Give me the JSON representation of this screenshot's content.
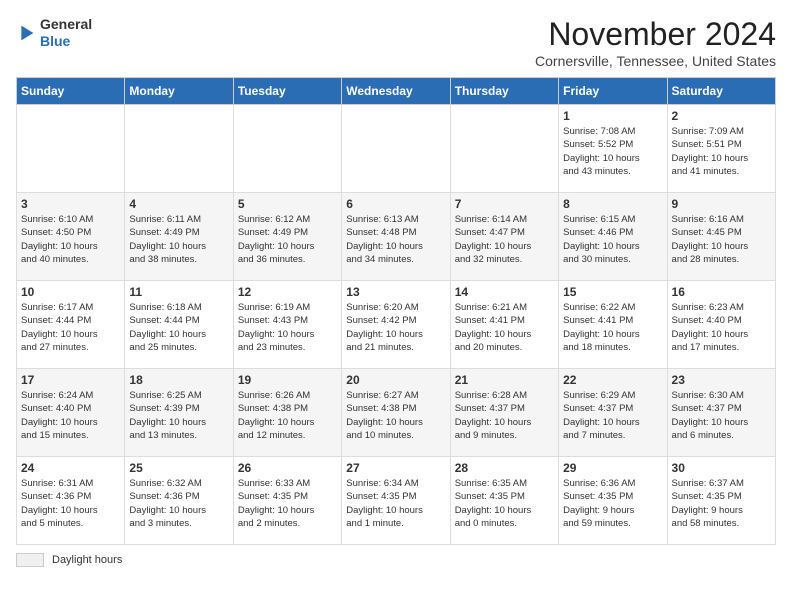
{
  "header": {
    "logo": {
      "general": "General",
      "blue": "Blue"
    },
    "month_title": "November 2024",
    "location": "Cornersville, Tennessee, United States"
  },
  "calendar": {
    "days_of_week": [
      "Sunday",
      "Monday",
      "Tuesday",
      "Wednesday",
      "Thursday",
      "Friday",
      "Saturday"
    ],
    "weeks": [
      [
        {
          "day": "",
          "info": ""
        },
        {
          "day": "",
          "info": ""
        },
        {
          "day": "",
          "info": ""
        },
        {
          "day": "",
          "info": ""
        },
        {
          "day": "",
          "info": ""
        },
        {
          "day": "1",
          "info": "Sunrise: 7:08 AM\nSunset: 5:52 PM\nDaylight: 10 hours\nand 43 minutes."
        },
        {
          "day": "2",
          "info": "Sunrise: 7:09 AM\nSunset: 5:51 PM\nDaylight: 10 hours\nand 41 minutes."
        }
      ],
      [
        {
          "day": "3",
          "info": "Sunrise: 6:10 AM\nSunset: 4:50 PM\nDaylight: 10 hours\nand 40 minutes."
        },
        {
          "day": "4",
          "info": "Sunrise: 6:11 AM\nSunset: 4:49 PM\nDaylight: 10 hours\nand 38 minutes."
        },
        {
          "day": "5",
          "info": "Sunrise: 6:12 AM\nSunset: 4:49 PM\nDaylight: 10 hours\nand 36 minutes."
        },
        {
          "day": "6",
          "info": "Sunrise: 6:13 AM\nSunset: 4:48 PM\nDaylight: 10 hours\nand 34 minutes."
        },
        {
          "day": "7",
          "info": "Sunrise: 6:14 AM\nSunset: 4:47 PM\nDaylight: 10 hours\nand 32 minutes."
        },
        {
          "day": "8",
          "info": "Sunrise: 6:15 AM\nSunset: 4:46 PM\nDaylight: 10 hours\nand 30 minutes."
        },
        {
          "day": "9",
          "info": "Sunrise: 6:16 AM\nSunset: 4:45 PM\nDaylight: 10 hours\nand 28 minutes."
        }
      ],
      [
        {
          "day": "10",
          "info": "Sunrise: 6:17 AM\nSunset: 4:44 PM\nDaylight: 10 hours\nand 27 minutes."
        },
        {
          "day": "11",
          "info": "Sunrise: 6:18 AM\nSunset: 4:44 PM\nDaylight: 10 hours\nand 25 minutes."
        },
        {
          "day": "12",
          "info": "Sunrise: 6:19 AM\nSunset: 4:43 PM\nDaylight: 10 hours\nand 23 minutes."
        },
        {
          "day": "13",
          "info": "Sunrise: 6:20 AM\nSunset: 4:42 PM\nDaylight: 10 hours\nand 21 minutes."
        },
        {
          "day": "14",
          "info": "Sunrise: 6:21 AM\nSunset: 4:41 PM\nDaylight: 10 hours\nand 20 minutes."
        },
        {
          "day": "15",
          "info": "Sunrise: 6:22 AM\nSunset: 4:41 PM\nDaylight: 10 hours\nand 18 minutes."
        },
        {
          "day": "16",
          "info": "Sunrise: 6:23 AM\nSunset: 4:40 PM\nDaylight: 10 hours\nand 17 minutes."
        }
      ],
      [
        {
          "day": "17",
          "info": "Sunrise: 6:24 AM\nSunset: 4:40 PM\nDaylight: 10 hours\nand 15 minutes."
        },
        {
          "day": "18",
          "info": "Sunrise: 6:25 AM\nSunset: 4:39 PM\nDaylight: 10 hours\nand 13 minutes."
        },
        {
          "day": "19",
          "info": "Sunrise: 6:26 AM\nSunset: 4:38 PM\nDaylight: 10 hours\nand 12 minutes."
        },
        {
          "day": "20",
          "info": "Sunrise: 6:27 AM\nSunset: 4:38 PM\nDaylight: 10 hours\nand 10 minutes."
        },
        {
          "day": "21",
          "info": "Sunrise: 6:28 AM\nSunset: 4:37 PM\nDaylight: 10 hours\nand 9 minutes."
        },
        {
          "day": "22",
          "info": "Sunrise: 6:29 AM\nSunset: 4:37 PM\nDaylight: 10 hours\nand 7 minutes."
        },
        {
          "day": "23",
          "info": "Sunrise: 6:30 AM\nSunset: 4:37 PM\nDaylight: 10 hours\nand 6 minutes."
        }
      ],
      [
        {
          "day": "24",
          "info": "Sunrise: 6:31 AM\nSunset: 4:36 PM\nDaylight: 10 hours\nand 5 minutes."
        },
        {
          "day": "25",
          "info": "Sunrise: 6:32 AM\nSunset: 4:36 PM\nDaylight: 10 hours\nand 3 minutes."
        },
        {
          "day": "26",
          "info": "Sunrise: 6:33 AM\nSunset: 4:35 PM\nDaylight: 10 hours\nand 2 minutes."
        },
        {
          "day": "27",
          "info": "Sunrise: 6:34 AM\nSunset: 4:35 PM\nDaylight: 10 hours\nand 1 minute."
        },
        {
          "day": "28",
          "info": "Sunrise: 6:35 AM\nSunset: 4:35 PM\nDaylight: 10 hours\nand 0 minutes."
        },
        {
          "day": "29",
          "info": "Sunrise: 6:36 AM\nSunset: 4:35 PM\nDaylight: 9 hours\nand 59 minutes."
        },
        {
          "day": "30",
          "info": "Sunrise: 6:37 AM\nSunset: 4:35 PM\nDaylight: 9 hours\nand 58 minutes."
        }
      ]
    ]
  },
  "legend": {
    "label": "Daylight hours"
  }
}
